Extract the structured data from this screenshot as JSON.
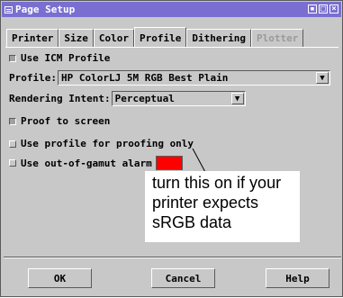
{
  "window": {
    "title": "Page Setup"
  },
  "tabs": [
    {
      "label": "Printer"
    },
    {
      "label": "Size"
    },
    {
      "label": "Color"
    },
    {
      "label": "Profile"
    },
    {
      "label": "Dithering"
    },
    {
      "label": "Plotter"
    }
  ],
  "profile_panel": {
    "use_icm_label": "Use ICM Profile",
    "profile_label": "Profile:",
    "profile_value": "HP ColorLJ 5M RGB Best Plain",
    "rendering_intent_label": "Rendering Intent:",
    "rendering_intent_value": "Perceptual",
    "proof_to_screen_label": "Proof to screen",
    "use_for_proofing_label": "Use profile for proofing only",
    "gamut_alarm_label": "Use out-of-gamut alarm",
    "gamut_alarm_color": "#ff0000"
  },
  "annotation": {
    "line1": "turn this on if your",
    "line2": "printer expects",
    "line3": "sRGB data"
  },
  "buttons": {
    "ok": "OK",
    "cancel": "Cancel",
    "help": "Help"
  }
}
